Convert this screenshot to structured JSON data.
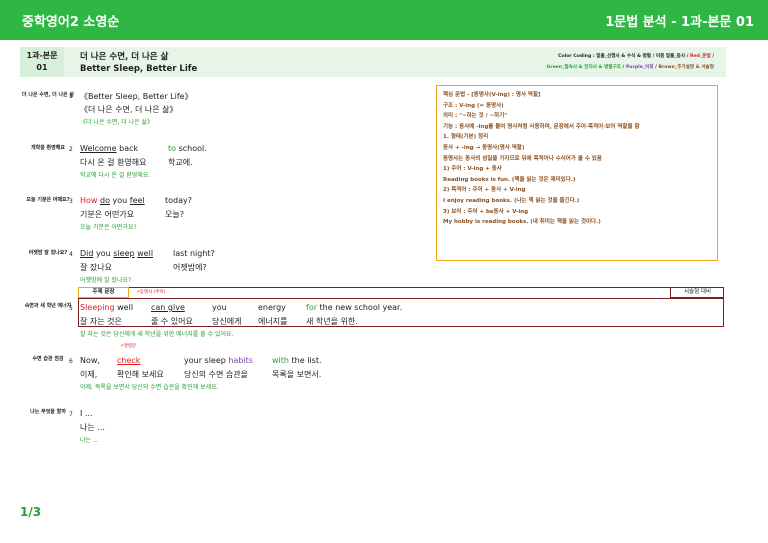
{
  "header": {
    "left": "중학영어2 소영순",
    "right": "1문법 분석 - 1과-본문 01"
  },
  "titlebar": {
    "lesson": "1과-본문 01",
    "title_ko": "더 나은 수면, 더 나은 삶",
    "title_en": "Better Sleep, Better Life",
    "color_coding": {
      "prefix": "Color Coding : 밑줄_선행사 & 수식 & 병렬 / 이중 밑줄_동사 / ",
      "red": "Red_문법",
      "mid": " /",
      "green": "Green_접속사 & 전치사 & 병렬구조",
      "sep1": " / ",
      "purple": "Purple_어휘",
      "sep2": " / ",
      "brown": "Brown_추가설명 & 서술형"
    }
  },
  "sentences": [
    {
      "num": "1",
      "summary": "더 나은 수면, 더 나은 삶",
      "en": "《Better Sleep, Better Life》",
      "ko": "《더 나은 수면, 더 나은 삶》",
      "tr": "《더 나은 수면, 더 나은 삶》"
    },
    {
      "num": "2",
      "summary": "개학을 환영해요",
      "en_a": "Welcome",
      "en_b": " back",
      "en_c": "to",
      "en_d": " school.",
      "ko_a": "다시 온 걸 환영해요",
      "ko_b": "학교에.",
      "tr": "학교에 다시 온 걸 환영해요."
    },
    {
      "num": "3",
      "summary": "오늘 기분은 어때요?",
      "en_a": "How",
      "en_b": "do",
      "en_c": "you",
      "en_d": "feel",
      "en_e": "today?",
      "ko_a": "기분은 어떤가요",
      "ko_b": "오늘?",
      "tr": "오늘 기분은 어떤가요?"
    },
    {
      "num": "4",
      "summary": "어젯밤 잘 잤나요?",
      "en_a": "Did",
      "en_b": " you ",
      "en_c": "sleep",
      "en_d": "well",
      "en_e": "last night?",
      "ko_a": "잘 잤나요",
      "ko_b": "어젯밤에?",
      "tr": "어젯밤에 잘 잤나요?"
    },
    {
      "num": "5",
      "summary": "숙면과 새 학년 에너지",
      "en_a": "Sleeping",
      "en_b": " well",
      "en_c": "can give",
      "en_d": "you",
      "en_e": "energy",
      "en_f": "for",
      "en_g": " the new school year.",
      "ko_a": "잘 자는 것은",
      "ko_b": "줄 수 있어요",
      "ko_c": "당신에게",
      "ko_d": "에너지를",
      "ko_e": "새 학년을 위한.",
      "tr": "잘 자는 것은 당신에게 새 학년을 위한 에너지를 줄 수 있어요."
    },
    {
      "num": "6",
      "summary": "수면 습관 점검",
      "en_a": "Now,",
      "en_b": "check",
      "en_c": "your sleep ",
      "en_d": "habits",
      "en_e": "with",
      "en_f": " the list.",
      "ko_a": "이제,",
      "ko_b": "확인해 보세요",
      "ko_c": "당신의 수면 습관을",
      "ko_d": "목록을 보면서.",
      "tr": "이제, 목록을 보면서 당신의 수면 습관을 확인해 보세요."
    },
    {
      "num": "7",
      "summary": "나는 무엇을 할까",
      "en": "I ...",
      "ko": "나는 ...",
      "tr": "나는 ..."
    }
  ],
  "grammar_box": {
    "lines": [
      "핵심 문법 - [동명사(V-ing) : 명사 역할]",
      "구조 : V-ing (= 동명사)",
      "의미 : \"~하는 것 / ~하기\"",
      "기능 : 동사에 -ing를 붙여 명사처럼 사용하며, 문장에서 주어·목적어·보어 역할을 함",
      "1. 형태(기본) 정리",
      "동사 + -ing → 동명사(명사 역할)",
      "동명사는 동사의 성질을 가지므로 뒤에 목적어나 수식어가 올 수 있음",
      "1) 주어 : V-ing + 동사",
      "Reading books is fun. (책을 읽는 것은 재미있다.)",
      "2) 목적어 : 주어 + 동사 + V-ing",
      "I enjoy reading books. (나는 책 읽는 것을 즐긴다.)",
      "3) 보어 : 주어 + be동사 + V-ing",
      "My hobby is reading books. (내 취미는 책을 읽는 것이다.)"
    ]
  },
  "labels": {
    "key_sentence": "주제 문장",
    "descriptive": "서술형 대비",
    "gerund_note": "↗동명사 (주어)",
    "imperative_note": "↗명령문"
  },
  "pager": "1/3",
  "colors": {
    "green_bar": "#2eb843",
    "red": "#e02020",
    "green": "#2a9d34",
    "purple": "#7b3fb0",
    "brown": "#8a4f1f",
    "orange_box": "#f2a81d"
  }
}
